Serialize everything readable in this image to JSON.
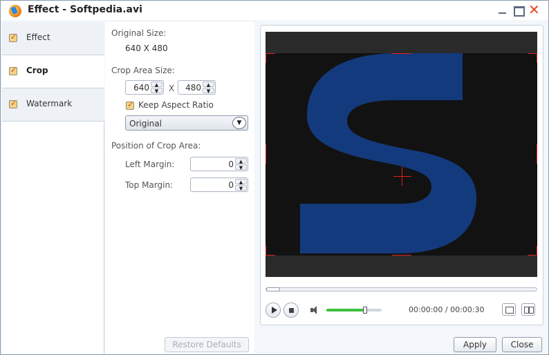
{
  "window": {
    "title": "Effect - Softpedia.avi",
    "icons": {
      "app": "app-icon",
      "minimize": "minimize-icon",
      "maximize": "maximize-icon",
      "close": "close-icon"
    },
    "close_glyph": "✕"
  },
  "sidebar": {
    "items": [
      {
        "label": "Effect",
        "checked": true,
        "active": false
      },
      {
        "label": "Crop",
        "checked": true,
        "active": true
      },
      {
        "label": "Watermark",
        "checked": true,
        "active": false
      }
    ]
  },
  "crop": {
    "original_size_label": "Original Size:",
    "original_size_value": "640 X 480",
    "crop_area_size_label": "Crop Area Size:",
    "width": "640",
    "separator": "X",
    "height": "480",
    "keep_aspect_ratio_label": "Keep Aspect Ratio",
    "keep_aspect_ratio_checked": true,
    "aspect_dropdown_value": "Original",
    "position_label": "Position of Crop Area:",
    "left_margin_label": "Left Margin:",
    "left_margin_value": "0",
    "top_margin_label": "Top Margin:",
    "top_margin_value": "0",
    "restore_defaults_label": "Restore Defaults",
    "restore_defaults_enabled": false
  },
  "preview": {
    "time": "00:00:00 / 00:00:30",
    "volume_level": 0.7,
    "seek_position": 0.0,
    "colors": {
      "logo": "#143a7e",
      "crop_marks": "#e02020",
      "volume": "#3cbf3c"
    }
  },
  "footer": {
    "apply_label": "Apply",
    "close_label": "Close"
  }
}
